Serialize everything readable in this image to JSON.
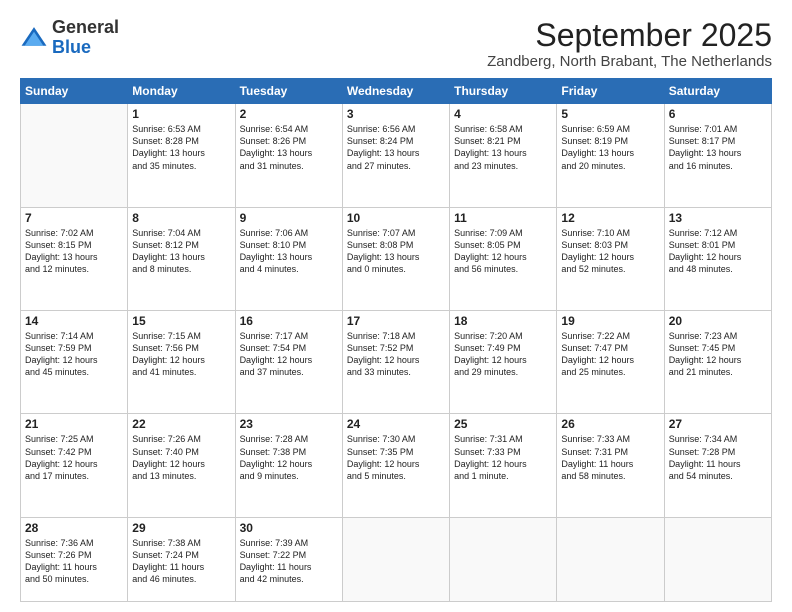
{
  "header": {
    "logo": {
      "general": "General",
      "blue": "Blue"
    },
    "title": "September 2025",
    "location": "Zandberg, North Brabant, The Netherlands"
  },
  "days_of_week": [
    "Sunday",
    "Monday",
    "Tuesday",
    "Wednesday",
    "Thursday",
    "Friday",
    "Saturday"
  ],
  "weeks": [
    [
      {
        "day": "",
        "content": ""
      },
      {
        "day": "1",
        "content": "Sunrise: 6:53 AM\nSunset: 8:28 PM\nDaylight: 13 hours\nand 35 minutes."
      },
      {
        "day": "2",
        "content": "Sunrise: 6:54 AM\nSunset: 8:26 PM\nDaylight: 13 hours\nand 31 minutes."
      },
      {
        "day": "3",
        "content": "Sunrise: 6:56 AM\nSunset: 8:24 PM\nDaylight: 13 hours\nand 27 minutes."
      },
      {
        "day": "4",
        "content": "Sunrise: 6:58 AM\nSunset: 8:21 PM\nDaylight: 13 hours\nand 23 minutes."
      },
      {
        "day": "5",
        "content": "Sunrise: 6:59 AM\nSunset: 8:19 PM\nDaylight: 13 hours\nand 20 minutes."
      },
      {
        "day": "6",
        "content": "Sunrise: 7:01 AM\nSunset: 8:17 PM\nDaylight: 13 hours\nand 16 minutes."
      }
    ],
    [
      {
        "day": "7",
        "content": "Sunrise: 7:02 AM\nSunset: 8:15 PM\nDaylight: 13 hours\nand 12 minutes."
      },
      {
        "day": "8",
        "content": "Sunrise: 7:04 AM\nSunset: 8:12 PM\nDaylight: 13 hours\nand 8 minutes."
      },
      {
        "day": "9",
        "content": "Sunrise: 7:06 AM\nSunset: 8:10 PM\nDaylight: 13 hours\nand 4 minutes."
      },
      {
        "day": "10",
        "content": "Sunrise: 7:07 AM\nSunset: 8:08 PM\nDaylight: 13 hours\nand 0 minutes."
      },
      {
        "day": "11",
        "content": "Sunrise: 7:09 AM\nSunset: 8:05 PM\nDaylight: 12 hours\nand 56 minutes."
      },
      {
        "day": "12",
        "content": "Sunrise: 7:10 AM\nSunset: 8:03 PM\nDaylight: 12 hours\nand 52 minutes."
      },
      {
        "day": "13",
        "content": "Sunrise: 7:12 AM\nSunset: 8:01 PM\nDaylight: 12 hours\nand 48 minutes."
      }
    ],
    [
      {
        "day": "14",
        "content": "Sunrise: 7:14 AM\nSunset: 7:59 PM\nDaylight: 12 hours\nand 45 minutes."
      },
      {
        "day": "15",
        "content": "Sunrise: 7:15 AM\nSunset: 7:56 PM\nDaylight: 12 hours\nand 41 minutes."
      },
      {
        "day": "16",
        "content": "Sunrise: 7:17 AM\nSunset: 7:54 PM\nDaylight: 12 hours\nand 37 minutes."
      },
      {
        "day": "17",
        "content": "Sunrise: 7:18 AM\nSunset: 7:52 PM\nDaylight: 12 hours\nand 33 minutes."
      },
      {
        "day": "18",
        "content": "Sunrise: 7:20 AM\nSunset: 7:49 PM\nDaylight: 12 hours\nand 29 minutes."
      },
      {
        "day": "19",
        "content": "Sunrise: 7:22 AM\nSunset: 7:47 PM\nDaylight: 12 hours\nand 25 minutes."
      },
      {
        "day": "20",
        "content": "Sunrise: 7:23 AM\nSunset: 7:45 PM\nDaylight: 12 hours\nand 21 minutes."
      }
    ],
    [
      {
        "day": "21",
        "content": "Sunrise: 7:25 AM\nSunset: 7:42 PM\nDaylight: 12 hours\nand 17 minutes."
      },
      {
        "day": "22",
        "content": "Sunrise: 7:26 AM\nSunset: 7:40 PM\nDaylight: 12 hours\nand 13 minutes."
      },
      {
        "day": "23",
        "content": "Sunrise: 7:28 AM\nSunset: 7:38 PM\nDaylight: 12 hours\nand 9 minutes."
      },
      {
        "day": "24",
        "content": "Sunrise: 7:30 AM\nSunset: 7:35 PM\nDaylight: 12 hours\nand 5 minutes."
      },
      {
        "day": "25",
        "content": "Sunrise: 7:31 AM\nSunset: 7:33 PM\nDaylight: 12 hours\nand 1 minute."
      },
      {
        "day": "26",
        "content": "Sunrise: 7:33 AM\nSunset: 7:31 PM\nDaylight: 11 hours\nand 58 minutes."
      },
      {
        "day": "27",
        "content": "Sunrise: 7:34 AM\nSunset: 7:28 PM\nDaylight: 11 hours\nand 54 minutes."
      }
    ],
    [
      {
        "day": "28",
        "content": "Sunrise: 7:36 AM\nSunset: 7:26 PM\nDaylight: 11 hours\nand 50 minutes."
      },
      {
        "day": "29",
        "content": "Sunrise: 7:38 AM\nSunset: 7:24 PM\nDaylight: 11 hours\nand 46 minutes."
      },
      {
        "day": "30",
        "content": "Sunrise: 7:39 AM\nSunset: 7:22 PM\nDaylight: 11 hours\nand 42 minutes."
      },
      {
        "day": "",
        "content": ""
      },
      {
        "day": "",
        "content": ""
      },
      {
        "day": "",
        "content": ""
      },
      {
        "day": "",
        "content": ""
      }
    ]
  ]
}
